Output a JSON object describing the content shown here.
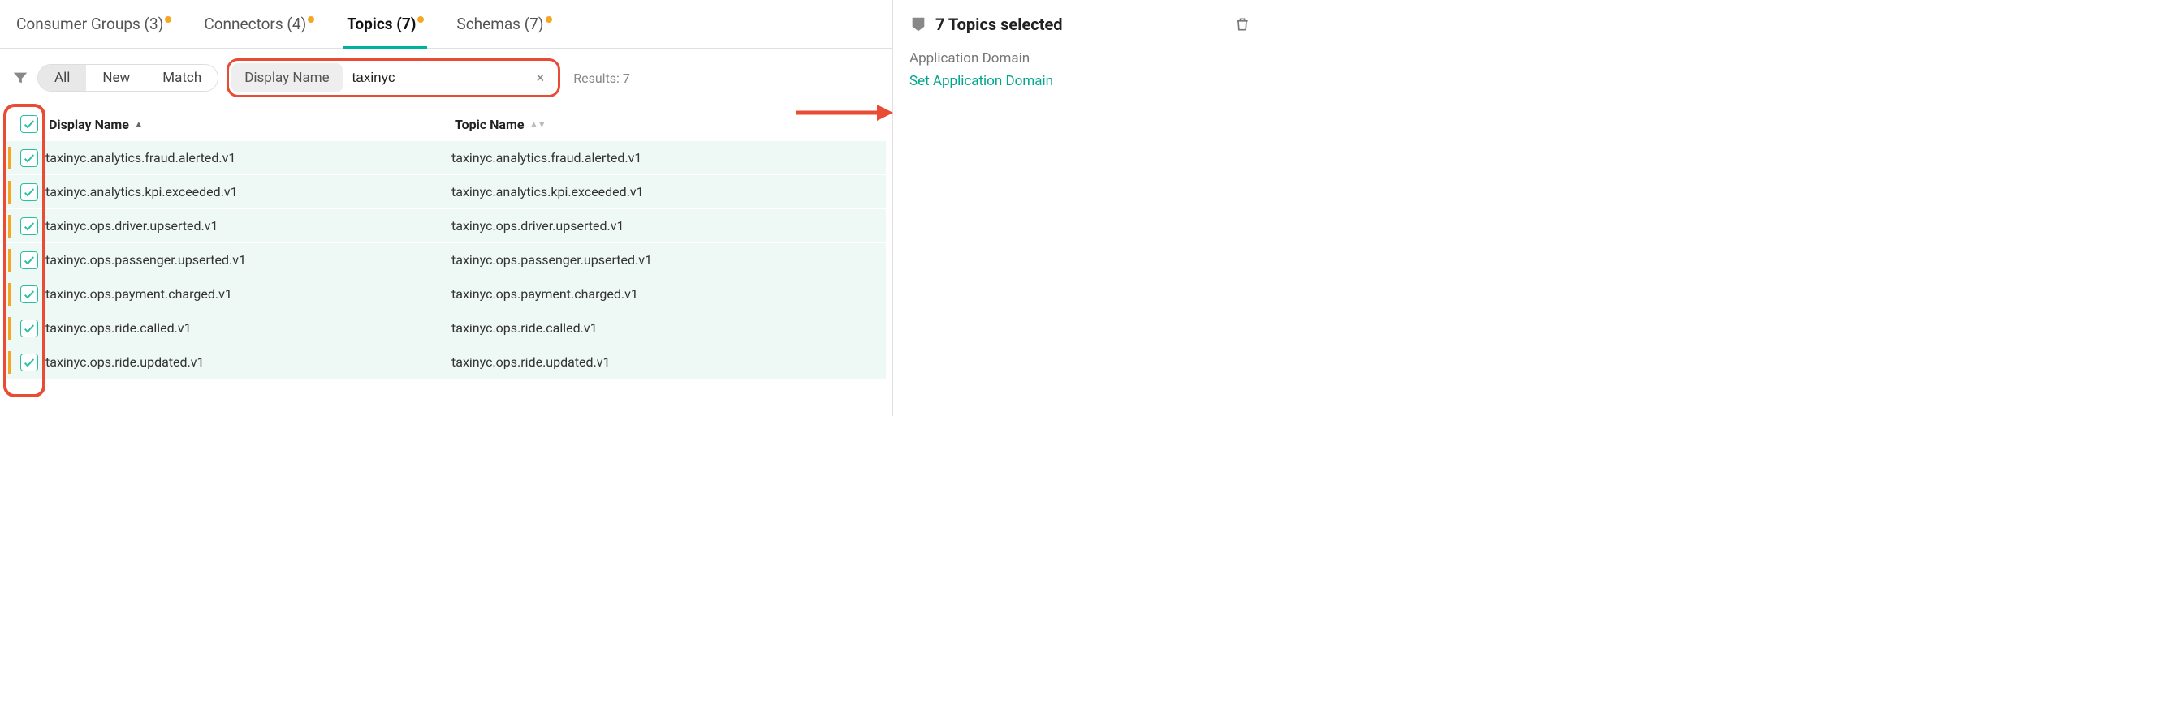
{
  "tabs": [
    {
      "label": "Consumer Groups (3)",
      "active": false,
      "dot": true
    },
    {
      "label": "Connectors (4)",
      "active": false,
      "dot": true
    },
    {
      "label": "Topics (7)",
      "active": true,
      "dot": true
    },
    {
      "label": "Schemas (7)",
      "active": false,
      "dot": true
    }
  ],
  "filters": {
    "pills": [
      {
        "label": "All",
        "active": true
      },
      {
        "label": "New",
        "active": false
      },
      {
        "label": "Match",
        "active": false
      }
    ],
    "search_label": "Display Name",
    "search_value": "taxinyc",
    "results_text": "Results: 7"
  },
  "columns": {
    "display_name": "Display Name",
    "topic_name": "Topic Name"
  },
  "rows": [
    {
      "display": "taxinyc.analytics.fraud.alerted.v1",
      "topic": "taxinyc.analytics.fraud.alerted.v1",
      "checked": true
    },
    {
      "display": "taxinyc.analytics.kpi.exceeded.v1",
      "topic": "taxinyc.analytics.kpi.exceeded.v1",
      "checked": true
    },
    {
      "display": "taxinyc.ops.driver.upserted.v1",
      "topic": "taxinyc.ops.driver.upserted.v1",
      "checked": true
    },
    {
      "display": "taxinyc.ops.passenger.upserted.v1",
      "topic": "taxinyc.ops.passenger.upserted.v1",
      "checked": true
    },
    {
      "display": "taxinyc.ops.payment.charged.v1",
      "topic": "taxinyc.ops.payment.charged.v1",
      "checked": true
    },
    {
      "display": "taxinyc.ops.ride.called.v1",
      "topic": "taxinyc.ops.ride.called.v1",
      "checked": true
    },
    {
      "display": "taxinyc.ops.ride.updated.v1",
      "topic": "taxinyc.ops.ride.updated.v1",
      "checked": true
    }
  ],
  "side": {
    "title": "7 Topics selected",
    "domain_label": "Application Domain",
    "set_domain": "Set Application Domain"
  }
}
